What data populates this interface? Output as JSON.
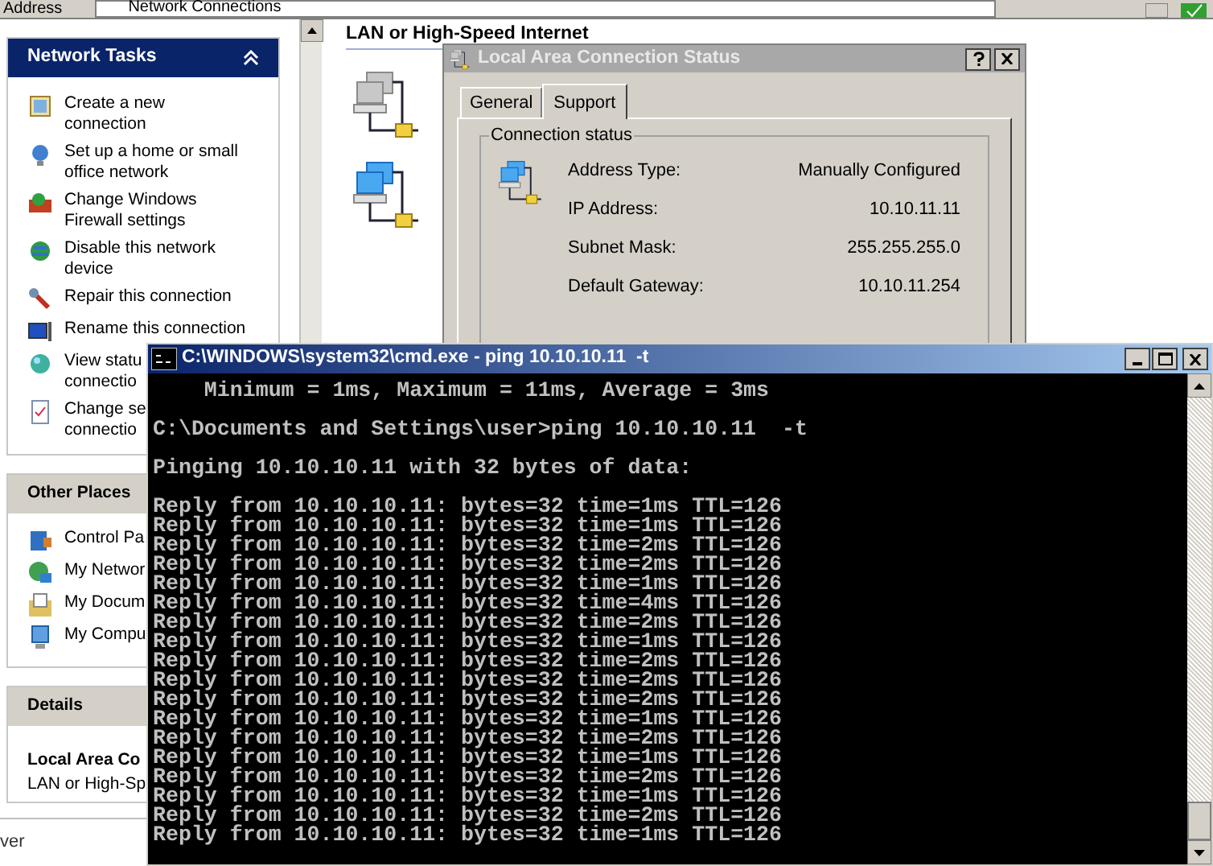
{
  "explorer": {
    "address_label": "Address",
    "address_value": "Network Connections",
    "group_title": "LAN or High-Speed Internet",
    "status_text": "ver",
    "panels": [
      {
        "kind": "tasks",
        "title": "Network Tasks",
        "expanded": true,
        "items": [
          {
            "lines": [
              "Create a new",
              "connection"
            ]
          },
          {
            "lines": [
              "Set up a home or small",
              "office network"
            ]
          },
          {
            "lines": [
              "Change Windows",
              "Firewall settings"
            ]
          },
          {
            "lines": [
              "Disable this network",
              "device"
            ]
          },
          {
            "lines": [
              "Repair this connection"
            ]
          },
          {
            "lines": [
              "Rename this connection"
            ]
          },
          {
            "lines": [
              "View statu",
              "connectio"
            ]
          },
          {
            "lines": [
              "Change se",
              "connectio"
            ]
          }
        ]
      },
      {
        "kind": "places",
        "title": "Other Places",
        "items": [
          {
            "lines": [
              "Control Pa"
            ]
          },
          {
            "lines": [
              "My Networ"
            ]
          },
          {
            "lines": [
              "My Docum"
            ]
          },
          {
            "lines": [
              "My Compu"
            ]
          }
        ]
      },
      {
        "kind": "details",
        "title": "Details",
        "name": "Local Area Co",
        "type": "LAN or High-Sp"
      }
    ]
  },
  "dialog": {
    "title": "Local Area Connection Status",
    "tabs": [
      {
        "label": "General",
        "selected": false
      },
      {
        "label": "Support",
        "selected": true
      }
    ],
    "group_title": "Connection status",
    "fields": [
      {
        "label": "Address Type:",
        "value": "Manually Configured"
      },
      {
        "label": "IP Address:",
        "value": "10.10.11.11"
      },
      {
        "label": "Subnet Mask:",
        "value": "255.255.255.0"
      },
      {
        "label": "Default Gateway:",
        "value": "10.10.11.254"
      }
    ]
  },
  "console": {
    "title": "C:\\WINDOWS\\system32\\cmd.exe - ping 10.10.10.11  -t",
    "blocks": [
      [
        "    Minimum = 1ms, Maximum = 11ms, Average = 3ms"
      ],
      [
        "C:\\Documents and Settings\\user>ping 10.10.10.11  -t"
      ],
      [
        "Pinging 10.10.10.11 with 32 bytes of data:"
      ],
      [
        "Reply from 10.10.10.11: bytes=32 time=1ms TTL=126",
        "Reply from 10.10.10.11: bytes=32 time=1ms TTL=126",
        "Reply from 10.10.10.11: bytes=32 time=2ms TTL=126",
        "Reply from 10.10.10.11: bytes=32 time=2ms TTL=126",
        "Reply from 10.10.10.11: bytes=32 time=1ms TTL=126",
        "Reply from 10.10.10.11: bytes=32 time=4ms TTL=126",
        "Reply from 10.10.10.11: bytes=32 time=2ms TTL=126",
        "Reply from 10.10.10.11: bytes=32 time=1ms TTL=126",
        "Reply from 10.10.10.11: bytes=32 time=2ms TTL=126",
        "Reply from 10.10.10.11: bytes=32 time=2ms TTL=126",
        "Reply from 10.10.10.11: bytes=32 time=2ms TTL=126",
        "Reply from 10.10.10.11: bytes=32 time=1ms TTL=126",
        "Reply from 10.10.10.11: bytes=32 time=2ms TTL=126",
        "Reply from 10.10.10.11: bytes=32 time=1ms TTL=126",
        "Reply from 10.10.10.11: bytes=32 time=2ms TTL=126",
        "Reply from 10.10.10.11: bytes=32 time=1ms TTL=126",
        "Reply from 10.10.10.11: bytes=32 time=2ms TTL=126",
        "Reply from 10.10.10.11: bytes=32 time=1ms TTL=126"
      ]
    ]
  }
}
